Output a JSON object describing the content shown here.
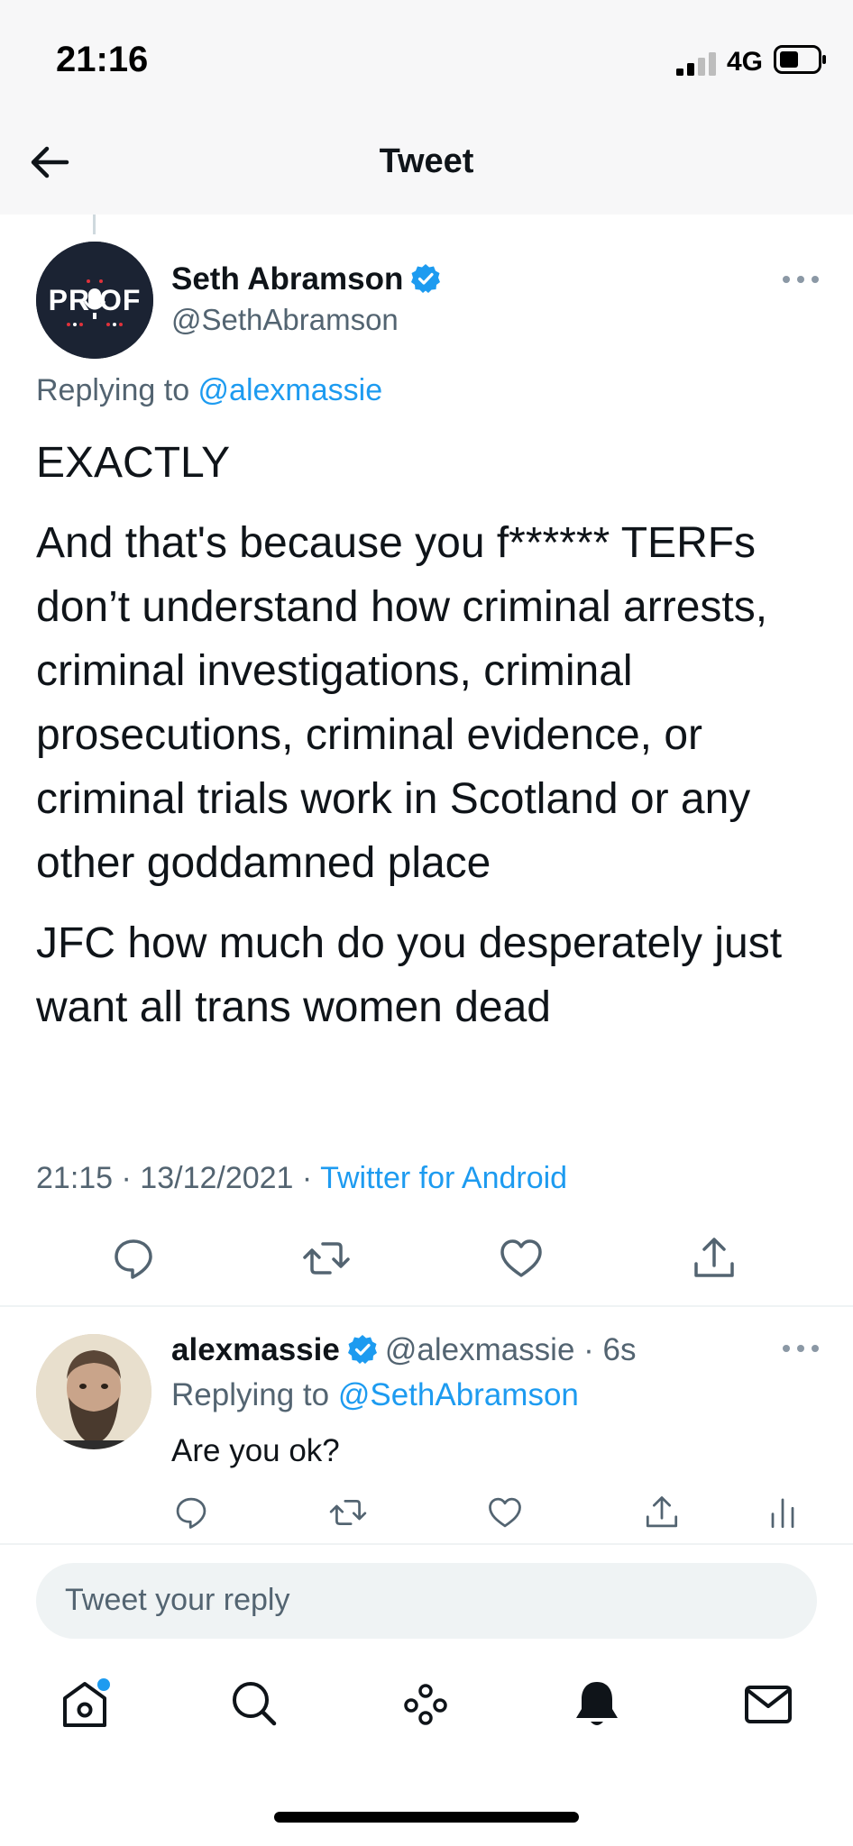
{
  "status_bar": {
    "time": "21:16",
    "network": "4G"
  },
  "nav": {
    "title": "Tweet"
  },
  "main_tweet": {
    "avatar_text": "PR OF",
    "author_name": "Seth Abramson",
    "author_handle": "@SethAbramson",
    "replying_prefix": "Replying to ",
    "replying_to": "@alexmassie",
    "paragraphs": [
      "EXACTLY",
      "And that's because you f****** TERFs don’t understand how criminal arrests, criminal investigations, criminal prosecutions, criminal evidence, or criminal trials work in Scotland or any other goddamned place",
      "JFC how much do you desperately just want all trans women dead"
    ],
    "timestamp": "21:15 · 13/12/2021 · ",
    "source": "Twitter for Android"
  },
  "reply_tweet": {
    "author_name": "alexmassie",
    "author_handle": "@alexmassie · 6s",
    "replying_prefix": "Replying to ",
    "replying_to": "@SethAbramson",
    "text": "Are you ok?"
  },
  "compose": {
    "placeholder": "Tweet your reply"
  },
  "icons": {
    "back": "back-arrow-icon",
    "verified": "verified-badge-icon",
    "more": "more-options-icon",
    "reply": "reply-icon",
    "retweet": "retweet-icon",
    "like": "like-icon",
    "share": "share-icon",
    "analytics": "analytics-icon",
    "home": "home-icon",
    "search": "search-icon",
    "spaces": "spaces-icon",
    "notifications": "bell-icon",
    "messages": "mail-icon"
  },
  "colors": {
    "accent": "#1d9bf0",
    "text": "#0f1419",
    "secondary": "#536471"
  }
}
